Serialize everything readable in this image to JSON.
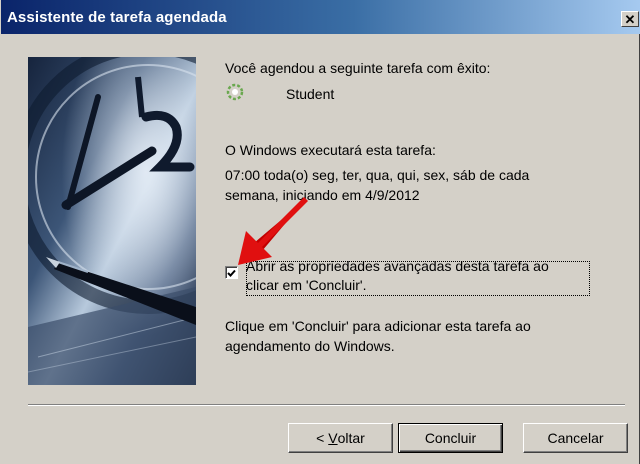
{
  "window": {
    "title": "Assistente de tarefa agendada",
    "close_label": "✕"
  },
  "summary": {
    "success_text": "Você agendou a seguinte tarefa com êxito:",
    "task_name": "Student",
    "task_icon": "scheduled-task-icon"
  },
  "schedule": {
    "intro": "O Windows executará esta tarefa:",
    "line1": "07:00 toda(o) seg, ter, qua, qui, sex, sáb de cada",
    "line2": "semana, iniciando em 4/9/2012"
  },
  "advanced_option": {
    "checked": true,
    "line1": "Abrir as propriedades avançadas desta tarefa ao",
    "line2": "clicar em 'Concluir'."
  },
  "finish_note": {
    "line1": "Clique em 'Concluir' para adicionar esta tarefa ao",
    "line2": "agendamento do Windows."
  },
  "buttons": {
    "back_prefix": "< ",
    "back_accel": "V",
    "back_rest": "oltar",
    "finish": "Concluir",
    "cancel": "Cancelar"
  },
  "colors": {
    "titlebar_start": "#0a246a",
    "titlebar_end": "#a6caf0",
    "face": "#d4d0c8",
    "arrow": "#e01010"
  }
}
